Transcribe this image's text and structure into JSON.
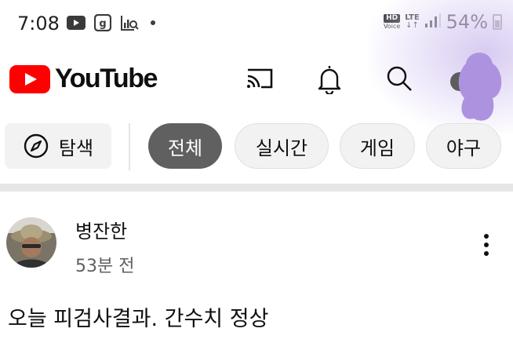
{
  "status_bar": {
    "time": "7:08",
    "icons": [
      "video-icon",
      "g-app-icon",
      "chart-search-icon",
      "dot-icon"
    ],
    "hd_label": "HD",
    "voice_label": "Voice",
    "network": "LTE",
    "battery": "54%",
    "battery_level": 0.54
  },
  "app_bar": {
    "logo_text": "YouTube",
    "actions": [
      "cast-icon",
      "bell-icon",
      "search-icon",
      "avatar"
    ]
  },
  "chips": {
    "explore": "탐색",
    "items": [
      "전체",
      "실시간",
      "게임",
      "야구"
    ],
    "selected": "전체"
  },
  "post": {
    "author": "병잔한",
    "time": "53분 전",
    "text": "오늘 피검사결과. 간수치 정상"
  },
  "colors": {
    "brand_red": "#ff0000",
    "chip_selected_bg": "#606060",
    "chip_bg": "#f2f2f2",
    "secondary_text": "#606060"
  }
}
